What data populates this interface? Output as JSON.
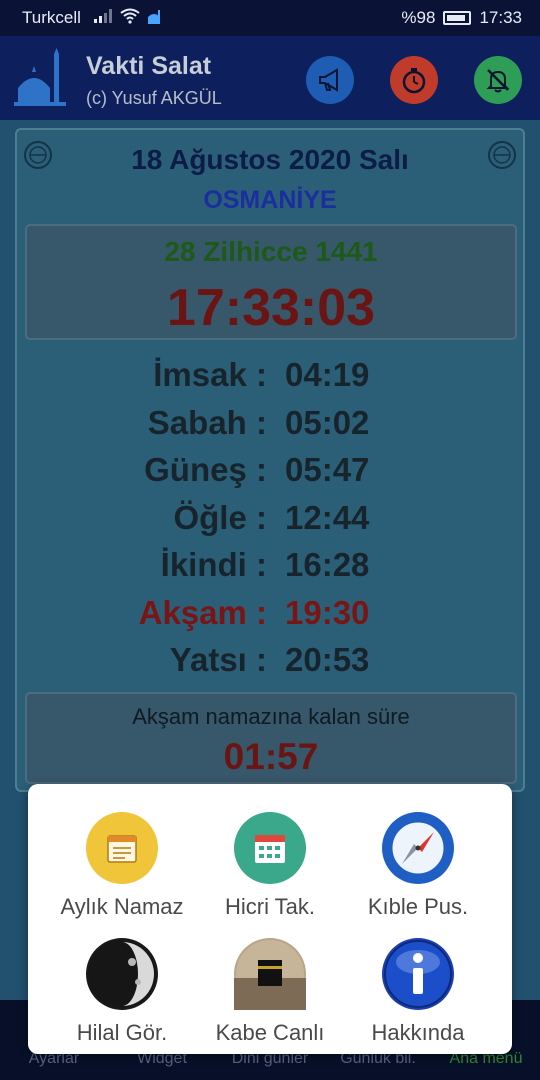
{
  "status_bar": {
    "carrier": "Turkcell",
    "battery": "%98",
    "time": "17:33"
  },
  "app_bar": {
    "title": "Vakti Salat",
    "subtitle": "(c) Yusuf AKGÜL"
  },
  "header": {
    "date": "18 Ağustos 2020 Salı",
    "city": "OSMANİYE"
  },
  "clock": {
    "hijri": "28 Zilhicce 1441",
    "time": "17:33:03"
  },
  "prayers": [
    {
      "name": "İmsak :",
      "time": "04:19"
    },
    {
      "name": "Sabah :",
      "time": "05:02"
    },
    {
      "name": "Güneş :",
      "time": "05:47"
    },
    {
      "name": "Öğle :",
      "time": "12:44"
    },
    {
      "name": "İkindi :",
      "time": "16:28"
    },
    {
      "name": "Akşam :",
      "time": "19:30"
    },
    {
      "name": "Yatsı :",
      "time": "20:53"
    }
  ],
  "remaining": {
    "label": "Akşam namazına kalan süre",
    "value": "01:57"
  },
  "menu": [
    {
      "label": "Aylık Namaz",
      "icon": "calendar-note-icon"
    },
    {
      "label": "Hicri Tak.",
      "icon": "calendar-icon"
    },
    {
      "label": "Kıble Pus.",
      "icon": "compass-icon"
    },
    {
      "label": "Hilal Gör.",
      "icon": "moon-icon"
    },
    {
      "label": "Kabe Canlı",
      "icon": "kaaba-icon"
    },
    {
      "label": "Hakkında",
      "icon": "info-icon"
    }
  ],
  "bottom_nav": [
    "Ayarlar",
    "Widget",
    "Dini günler",
    "Günlük bil.",
    "Ana menü"
  ],
  "colors": {
    "active_prayer": "#7a1515",
    "hijri": "#1d5a18",
    "app_bar": "#0d1f5c"
  }
}
